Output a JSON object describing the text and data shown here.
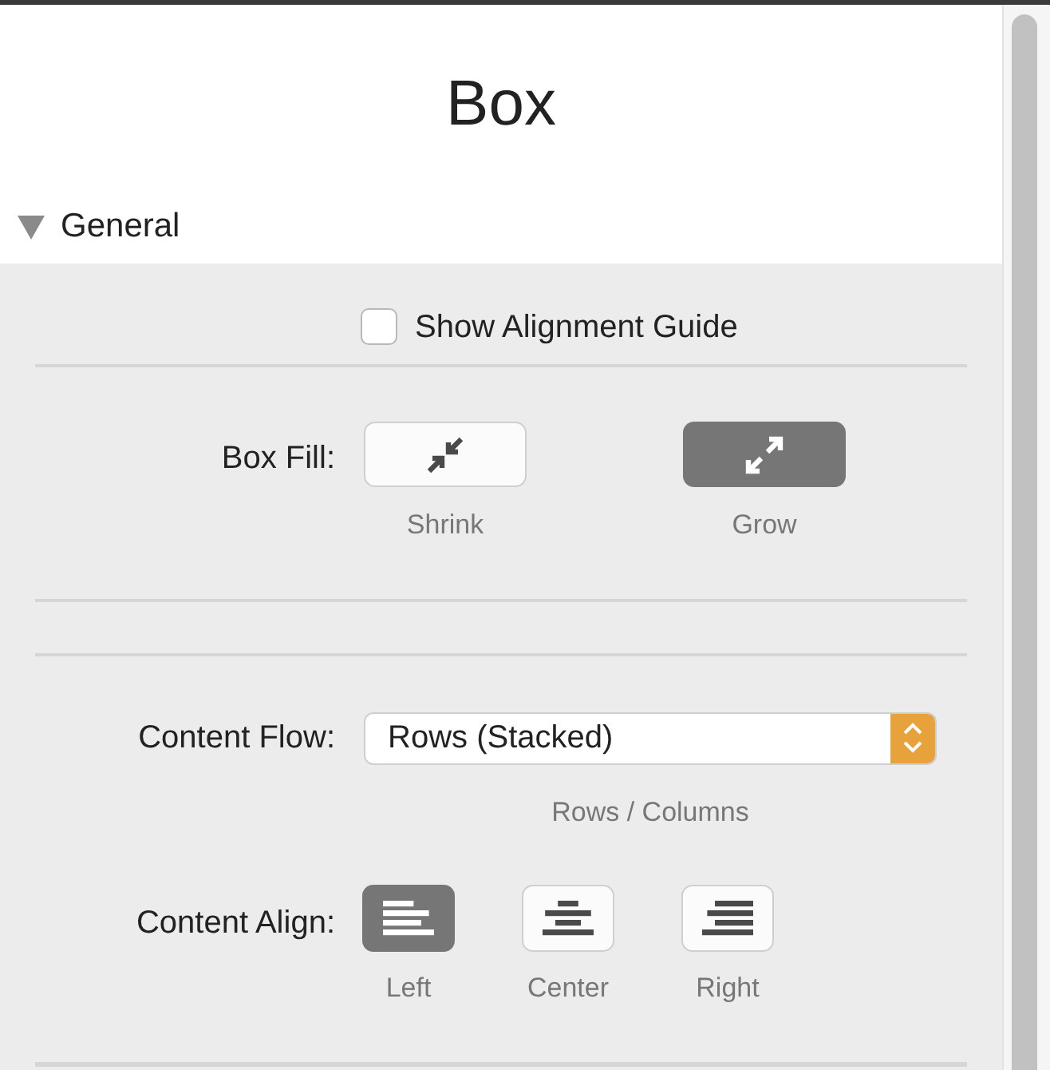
{
  "title": "Box",
  "section": {
    "label": "General",
    "expanded": true
  },
  "alignment_guide": {
    "label": "Show Alignment Guide",
    "checked": false
  },
  "box_fill": {
    "label": "Box Fill:",
    "options": [
      {
        "label": "Shrink",
        "kind": "shrink",
        "selected": false
      },
      {
        "label": "Grow",
        "kind": "grow",
        "selected": true
      }
    ]
  },
  "content_flow": {
    "label": "Content Flow:",
    "value": "Rows (Stacked)",
    "caption": "Rows / Columns"
  },
  "content_align": {
    "label": "Content Align:",
    "options": [
      {
        "label": "Left",
        "kind": "left",
        "selected": true
      },
      {
        "label": "Center",
        "kind": "center",
        "selected": false
      },
      {
        "label": "Right",
        "kind": "right",
        "selected": false
      }
    ]
  }
}
